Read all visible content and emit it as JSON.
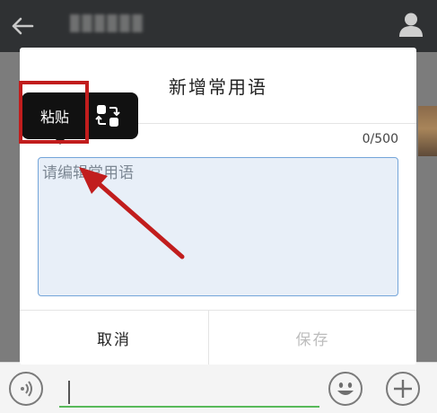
{
  "header": {
    "title": "",
    "icons": {
      "back": "back-arrow-icon",
      "profile": "user-profile-icon"
    }
  },
  "dialog": {
    "title": "新增常用语",
    "char_count": "0/500",
    "input": {
      "value": "",
      "placeholder": "请编辑常用语"
    },
    "cancel_label": "取消",
    "save_label": "保存"
  },
  "popup": {
    "paste_label": "粘贴",
    "icons": {
      "swap": "swap-icon"
    }
  },
  "bottom_bar": {
    "icons": {
      "voice": "voice-icon",
      "emoji": "emoji-icon",
      "plus": "plus-icon"
    }
  },
  "annotations": {
    "color": "#c11d1d",
    "highlight": "paste-button",
    "arrow_target": "phrase-input"
  },
  "colors": {
    "topbar": "#2f3133",
    "overlay": "#7c7c7c",
    "input_border": "#74a5d9",
    "input_bg": "#e8eff8",
    "accent_green": "#58b95a",
    "save_disabled": "#bdbdbd"
  }
}
